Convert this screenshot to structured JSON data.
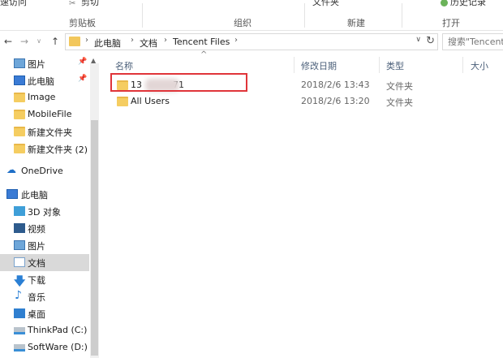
{
  "ribbon": {
    "clip_left": "速访问",
    "clip_cut": "剪切",
    "clip_folder": "文件夹",
    "clip_history": "历史记录",
    "groups": [
      "剪贴板",
      "组织",
      "新建",
      "打开"
    ]
  },
  "address": {
    "crumbs": [
      "此电脑",
      "文档",
      "Tencent Files"
    ],
    "search_placeholder": "搜索\"Tencent F"
  },
  "nav": {
    "items": [
      {
        "label": "图片",
        "icon": "pictures-icon",
        "pinned": true
      },
      {
        "label": "此电脑",
        "icon": "pc-icon",
        "pinned": true
      },
      {
        "label": "Image",
        "icon": "folder-icon"
      },
      {
        "label": "MobileFile",
        "icon": "folder-icon"
      },
      {
        "label": "新建文件夹",
        "icon": "folder-icon"
      },
      {
        "label": "新建文件夹 (2)",
        "icon": "folder-icon"
      },
      {
        "label": "OneDrive",
        "icon": "onedrive-icon"
      },
      {
        "label": "此电脑",
        "icon": "pc-icon"
      },
      {
        "label": "3D 对象",
        "icon": "3d-objects-icon"
      },
      {
        "label": "视频",
        "icon": "videos-icon"
      },
      {
        "label": "图片",
        "icon": "pictures-icon"
      },
      {
        "label": "文档",
        "icon": "documents-icon",
        "selected": true
      },
      {
        "label": "下载",
        "icon": "downloads-icon"
      },
      {
        "label": "音乐",
        "icon": "music-icon"
      },
      {
        "label": "桌面",
        "icon": "desktop-icon"
      },
      {
        "label": "ThinkPad (C:)",
        "icon": "drive-icon"
      },
      {
        "label": "SoftWare (D:)",
        "icon": "drive-icon"
      }
    ]
  },
  "columns": [
    "名称",
    "修改日期",
    "类型",
    "大小"
  ],
  "files": [
    {
      "name": "13",
      "name_tail": "71",
      "date": "2018/2/6 13:43",
      "type": "文件夹",
      "highlighted": true
    },
    {
      "name": "All Users",
      "date": "2018/2/6 13:20",
      "type": "文件夹"
    }
  ],
  "colors": {
    "highlight": "#e0353a",
    "folder": "#f5cd61",
    "selected_bg": "#d9d9d9"
  }
}
